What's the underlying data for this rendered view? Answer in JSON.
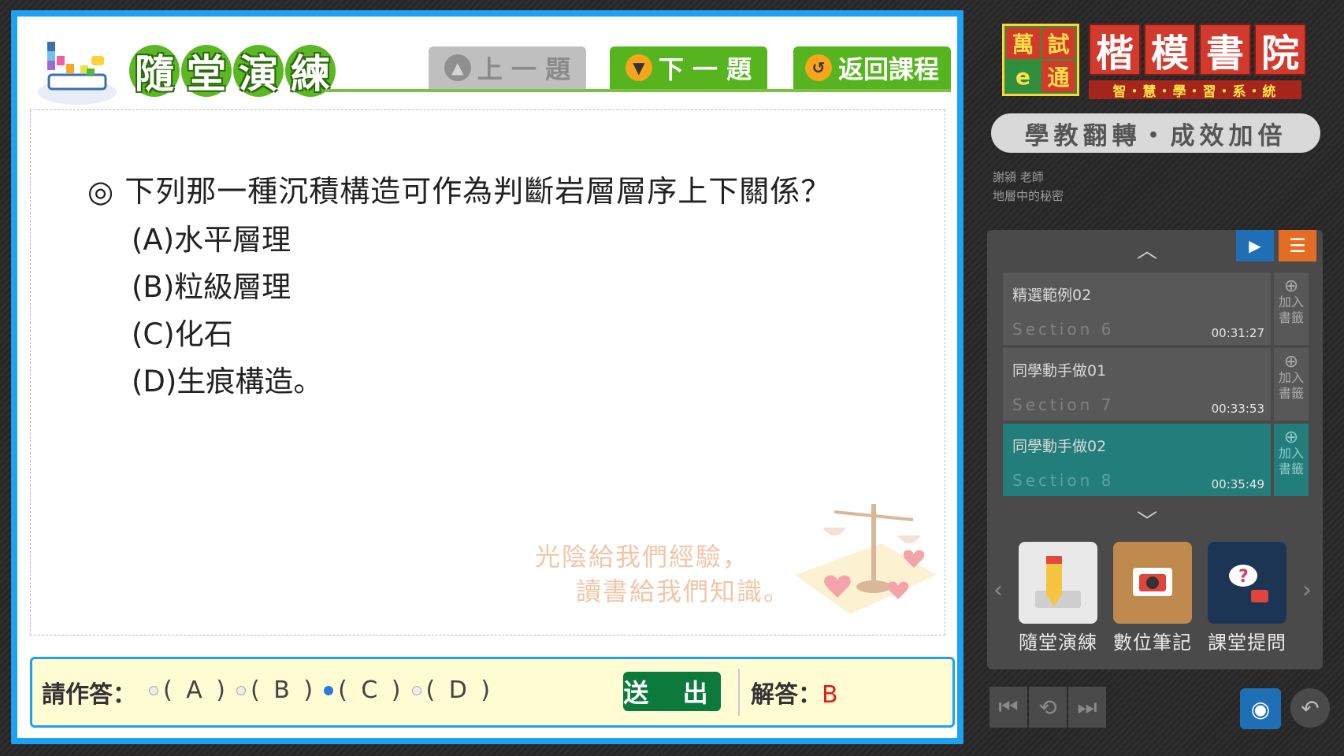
{
  "header": {
    "logo_title_chars": [
      "隨",
      "堂",
      "演",
      "練"
    ],
    "prev_label": "上 一 題",
    "next_label": "下 一 題",
    "back_label": "返回課程"
  },
  "question": {
    "text": "◎ 下列那一種沉積構造可作為判斷岩層層序上下關係？",
    "options": [
      "(A)水平層理",
      "(B)粒級層理",
      "(C)化石",
      "(D)生痕構造。"
    ]
  },
  "watermark": {
    "line1": "光陰給我們經驗，",
    "line2": "讀書給我們知識。"
  },
  "answer_bar": {
    "prompt": "請作答：",
    "choices": [
      "( A )",
      "( B )",
      "( C )",
      "( D )"
    ],
    "selected_index": 2,
    "submit_label": "送 出",
    "solution_label": "解答：",
    "solution_value": "B"
  },
  "brand": {
    "stamp": [
      "萬",
      "試",
      "e",
      "通"
    ],
    "title": [
      "楷",
      "模",
      "書",
      "院"
    ],
    "subtitle": "智・慧・學・習・系・統",
    "slogan": "學教翻轉・成效加倍"
  },
  "teacher": {
    "name": "謝潁 老師",
    "course": "地層中的秘密"
  },
  "playlist": {
    "items": [
      {
        "name": "精選範例02",
        "section": "Section 6",
        "time": "00:31:27",
        "bookmark": "加入書籤",
        "active": false
      },
      {
        "name": "同學動手做01",
        "section": "Section 7",
        "time": "00:33:53",
        "bookmark": "加入書籤",
        "active": false
      },
      {
        "name": "同學動手做02",
        "section": "Section 8",
        "time": "00:35:49",
        "bookmark": "加入書籤",
        "active": true
      }
    ]
  },
  "tools": [
    {
      "label": "隨堂演練",
      "icon": "pencil-book-icon"
    },
    {
      "label": "數位筆記",
      "icon": "camera-notebook-icon"
    },
    {
      "label": "課堂提問",
      "icon": "question-screen-icon"
    }
  ],
  "colors": {
    "frame_blue": "#1da1f2",
    "button_green": "#56b51f",
    "submit_green": "#0b7a3b",
    "active_teal": "#237d7a",
    "answer_red": "#e21b1b",
    "brand_red": "#d13a2c"
  }
}
